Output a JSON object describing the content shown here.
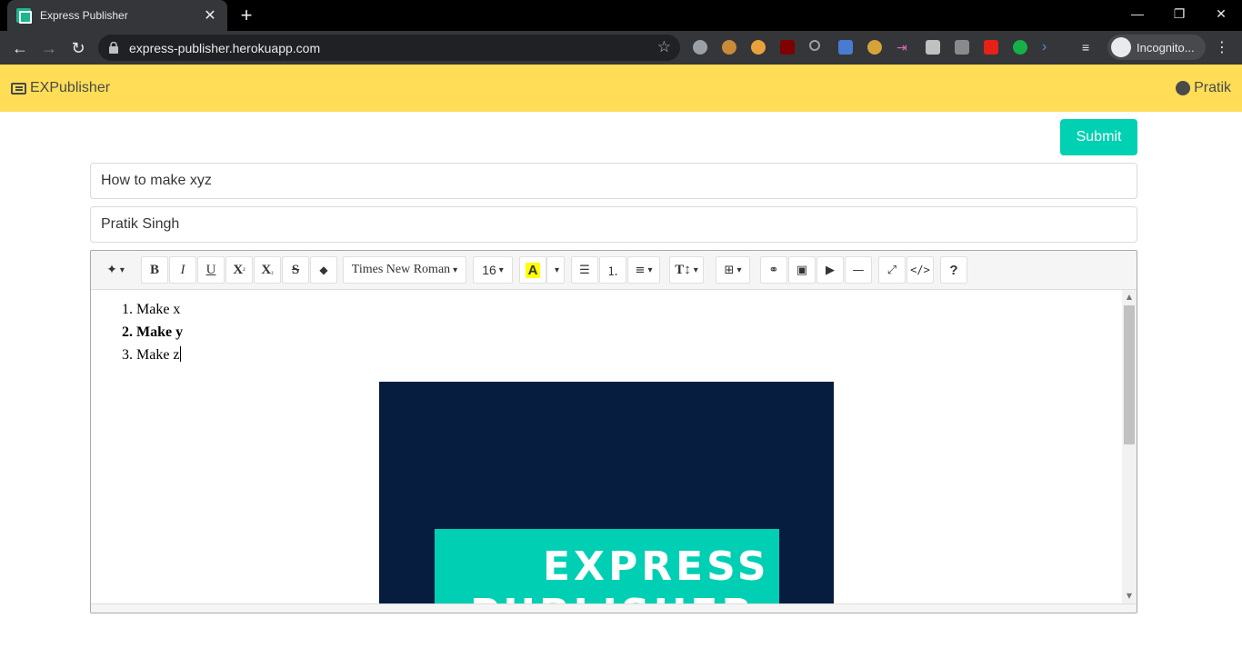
{
  "browser": {
    "tab_title": "Express Publisher",
    "tab_close": "✕",
    "new_tab": "+",
    "url": "express-publisher.herokuapp.com",
    "incognito_label": "Incognito..."
  },
  "app": {
    "brand": "EXPublisher",
    "user": "Pratik",
    "submit_label": "Submit",
    "title_value": "How to make xyz",
    "author_value": "Pratik Singh"
  },
  "editor": {
    "font_name": "Times New Roman",
    "font_size": "16",
    "list_items": [
      "Make x",
      "Make y",
      "Make z"
    ],
    "poster_line1": "EXPRESS",
    "poster_line2": "PUBLISHER"
  },
  "colors": {
    "navbar": "#ffdd57",
    "primary": "#00d1b2",
    "poster_bg": "#061d40"
  }
}
